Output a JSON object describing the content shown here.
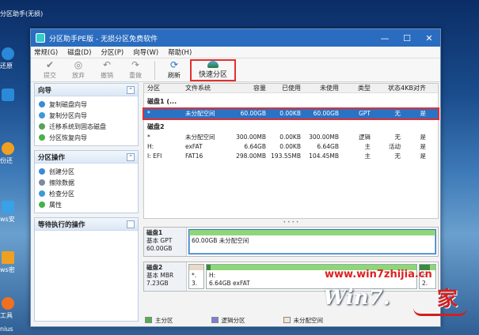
{
  "desktop": {
    "top_label": "分区助手(无损)",
    "icons": [
      {
        "label": "还原",
        "icon": "restore-icon",
        "color": "#2a88d8"
      },
      {
        "label": "",
        "icon": "gear-icon",
        "color": "#2a8ad8"
      },
      {
        "label": "份还",
        "icon": "backup-icon",
        "color": "#f0a020"
      },
      {
        "label": "ws安",
        "icon": "windows-install-icon",
        "color": "#3aa0e8"
      },
      {
        "label": "ws密",
        "icon": "windows-password-icon",
        "color": "#f0a020"
      },
      {
        "label": "工具",
        "icon": "tools-icon",
        "color": "#f07020"
      },
      {
        "label": "nius",
        "icon": "genius-icon",
        "color": "#e84a2a"
      }
    ]
  },
  "window": {
    "title": "分区助手PE版 - 无损分区免费软件",
    "controls": {
      "minimize": "—",
      "maximize": "☐",
      "close": "✕"
    },
    "menu": [
      "常规(G)",
      "磁盘(D)",
      "分区(P)",
      "向导(W)",
      "帮助(H)"
    ],
    "toolbar": {
      "buttons": [
        {
          "label": "提交",
          "icon": "check-icon",
          "active": false
        },
        {
          "label": "放弃",
          "icon": "discard-icon",
          "active": false
        },
        {
          "label": "撤销",
          "icon": "undo-icon",
          "active": false
        },
        {
          "label": "重做",
          "icon": "redo-icon",
          "active": false
        },
        {
          "label": "刷新",
          "icon": "refresh-icon",
          "active": true
        }
      ],
      "quick_partition": "快速分区"
    }
  },
  "left": {
    "wizard": {
      "title": "向导",
      "items": [
        "复制磁盘向导",
        "复制分区向导",
        "迁移系统到固态磁盘",
        "分区恢复向导"
      ]
    },
    "partition_ops": {
      "title": "分区操作",
      "items": [
        "创建分区",
        "擦除数据",
        "检查分区",
        "属性"
      ]
    },
    "pending": {
      "title": "等待执行的操作"
    }
  },
  "table": {
    "headers": [
      "分区",
      "文件系统",
      "容量",
      "已使用",
      "未使用",
      "类型",
      "状态",
      "4KB对齐"
    ],
    "disk1": {
      "label": "磁盘1 (...",
      "rows": [
        [
          "*",
          "未分配空间",
          "60.00GB",
          "0.00KB",
          "60.00GB",
          "GPT",
          "无",
          "是"
        ]
      ]
    },
    "disk2": {
      "label": "磁盘2",
      "rows": [
        [
          "*",
          "未分配空间",
          "300.00MB",
          "0.00KB",
          "300.00MB",
          "逻辑",
          "无",
          "是"
        ],
        [
          "H:",
          "exFAT",
          "6.64GB",
          "0.00KB",
          "6.64GB",
          "主",
          "活动",
          "是"
        ],
        [
          "I: EFI",
          "FAT16",
          "298.00MB",
          "193.55MB",
          "104.45MB",
          "主",
          "无",
          "是"
        ]
      ]
    }
  },
  "disk_map": {
    "disk1": {
      "name": "磁盘1",
      "type": "基本 GPT",
      "size": "60.00GB",
      "bars": [
        {
          "label": "60.00GB 未分配空间",
          "fill_color": "#8fd67a",
          "used_fraction": 0
        }
      ]
    },
    "disk2": {
      "name": "磁盘2",
      "type": "基本 MBR",
      "size": "7.23GB",
      "bars": [
        {
          "label": "*.",
          "sub": "3.",
          "fill_color": "#e8d9c8",
          "used_fraction": 0
        },
        {
          "label": "H:",
          "sub": "6.64GB exFAT",
          "fill_color": "#8fd67a",
          "used_fraction": 0.02
        },
        {
          "label": "I:",
          "sub": "2.",
          "fill_color": "#8fd67a",
          "used_fraction": 0.65
        }
      ]
    }
  },
  "legend": [
    {
      "label": "主分区",
      "color": "#4fb04f"
    },
    {
      "label": "逻辑分区",
      "color": "#7d7dd6"
    },
    {
      "label": "未分配空间",
      "color": "#f4e4d4"
    }
  ],
  "watermark": {
    "url": "www.win7zhijia.cn",
    "brand": "Win7.",
    "family": "家"
  }
}
